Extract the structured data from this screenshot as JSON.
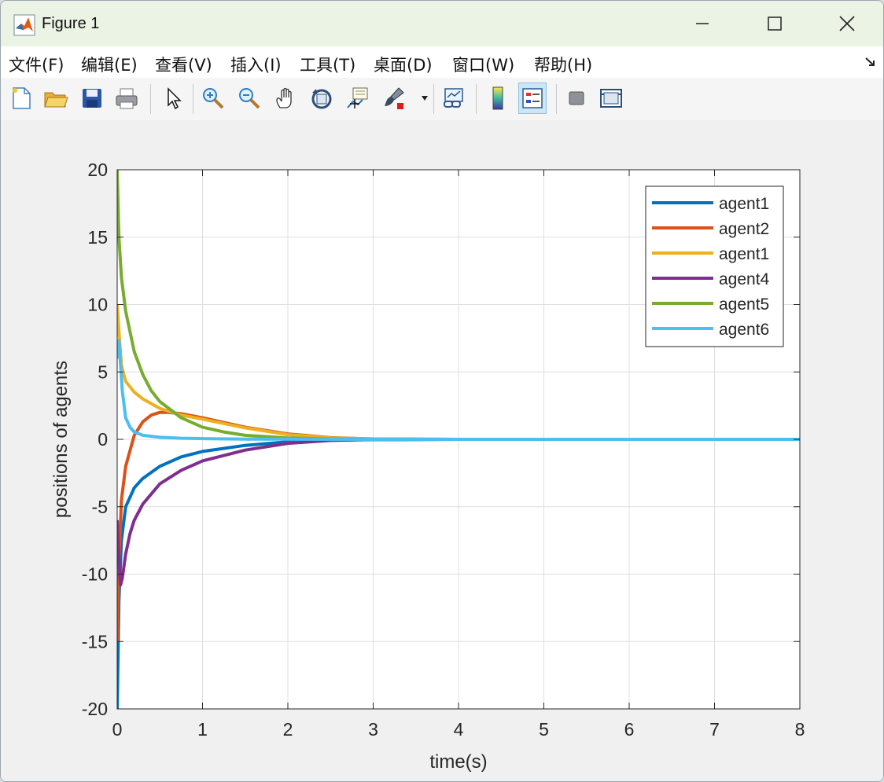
{
  "window": {
    "title": "Figure 1"
  },
  "menu": [
    {
      "label": "文件(F)"
    },
    {
      "label": "编辑(E)"
    },
    {
      "label": "查看(V)"
    },
    {
      "label": "插入(I)"
    },
    {
      "label": "工具(T)"
    },
    {
      "label": "桌面(D)"
    },
    {
      "label": "窗口(W)"
    },
    {
      "label": "帮助(H)"
    }
  ],
  "toolbar": {
    "icons": [
      "new-figure-icon",
      "open-file-icon",
      "save-icon",
      "print-icon",
      "pointer-icon",
      "zoom-in-icon",
      "zoom-out-icon",
      "pan-hand-icon",
      "rotate-3d-icon",
      "data-cursor-icon",
      "brush-icon",
      "link-plot-icon",
      "colorbar-icon",
      "legend-icon",
      "hide-plot-tools-icon",
      "show-plot-tools-icon"
    ]
  },
  "chart_data": {
    "type": "line",
    "xlabel": "time(s)",
    "ylabel": "positions of agents",
    "xlim": [
      0,
      8
    ],
    "ylim": [
      -20,
      20
    ],
    "xticks": [
      0,
      1,
      2,
      3,
      4,
      5,
      6,
      7,
      8
    ],
    "yticks": [
      -20,
      -15,
      -10,
      -5,
      0,
      5,
      10,
      15,
      20
    ],
    "grid": true,
    "legend_position": "top-right",
    "series": [
      {
        "name": "agent1",
        "color": "#0072BD",
        "x": [
          0,
          0.02,
          0.05,
          0.1,
          0.2,
          0.3,
          0.5,
          0.75,
          1.0,
          1.5,
          2.0,
          2.5,
          3.0,
          4,
          5,
          6,
          7,
          8
        ],
        "y": [
          -20,
          -12,
          -7.5,
          -5.0,
          -3.6,
          -2.9,
          -2.0,
          -1.3,
          -0.9,
          -0.45,
          -0.18,
          -0.06,
          -0.02,
          0,
          0,
          0,
          0,
          0
        ]
      },
      {
        "name": "agent2",
        "color": "#D95319",
        "x": [
          0,
          0.02,
          0.05,
          0.1,
          0.2,
          0.3,
          0.4,
          0.5,
          0.6,
          0.75,
          1.0,
          1.5,
          2.0,
          2.5,
          3.0,
          4,
          5,
          6,
          7,
          8
        ],
        "y": [
          -15,
          -9,
          -4.5,
          -2.0,
          0.3,
          1.3,
          1.8,
          2.0,
          2.0,
          1.9,
          1.6,
          0.9,
          0.4,
          0.12,
          0.03,
          0,
          0,
          0,
          0,
          0
        ]
      },
      {
        "name": "agent1",
        "color": "#EDB120",
        "x": [
          0,
          0.02,
          0.05,
          0.1,
          0.2,
          0.3,
          0.5,
          0.75,
          1.0,
          1.5,
          2.0,
          2.5,
          3.0,
          4,
          5,
          6,
          7,
          8
        ],
        "y": [
          10,
          8.0,
          5.5,
          4.3,
          3.5,
          3.0,
          2.3,
          1.8,
          1.5,
          0.85,
          0.35,
          0.1,
          0.03,
          0,
          0,
          0,
          0,
          0
        ]
      },
      {
        "name": "agent4",
        "color": "#7E2F8E",
        "x": [
          0,
          0.02,
          0.04,
          0.06,
          0.1,
          0.15,
          0.2,
          0.3,
          0.5,
          0.75,
          1.0,
          1.5,
          2.0,
          2.5,
          3.0,
          4,
          5,
          6,
          7,
          8
        ],
        "y": [
          -6,
          -9,
          -10.8,
          -10.3,
          -8.5,
          -7.0,
          -6.0,
          -4.8,
          -3.3,
          -2.3,
          -1.6,
          -0.8,
          -0.3,
          -0.08,
          -0.02,
          0,
          0,
          0,
          0,
          0
        ]
      },
      {
        "name": "agent5",
        "color": "#77AC30",
        "x": [
          0,
          0.02,
          0.05,
          0.1,
          0.2,
          0.3,
          0.4,
          0.5,
          0.75,
          1.0,
          1.25,
          1.5,
          2.0,
          2.5,
          3.0,
          4,
          5,
          6,
          7,
          8
        ],
        "y": [
          20,
          15,
          12,
          9.5,
          6.5,
          4.8,
          3.6,
          2.8,
          1.6,
          0.9,
          0.55,
          0.3,
          0.1,
          0.03,
          0.01,
          0,
          0,
          0,
          0,
          0
        ]
      },
      {
        "name": "agent6",
        "color": "#4DBEEE",
        "x": [
          0,
          0.02,
          0.04,
          0.06,
          0.1,
          0.15,
          0.2,
          0.3,
          0.5,
          0.75,
          1.0,
          1.5,
          2.0,
          3.0,
          4,
          5,
          6,
          7,
          8
        ],
        "y": [
          6,
          7.3,
          5.5,
          3.6,
          1.6,
          0.9,
          0.55,
          0.3,
          0.15,
          0.08,
          0.05,
          0.02,
          0.01,
          0,
          0,
          0,
          0,
          0,
          0
        ]
      }
    ]
  }
}
